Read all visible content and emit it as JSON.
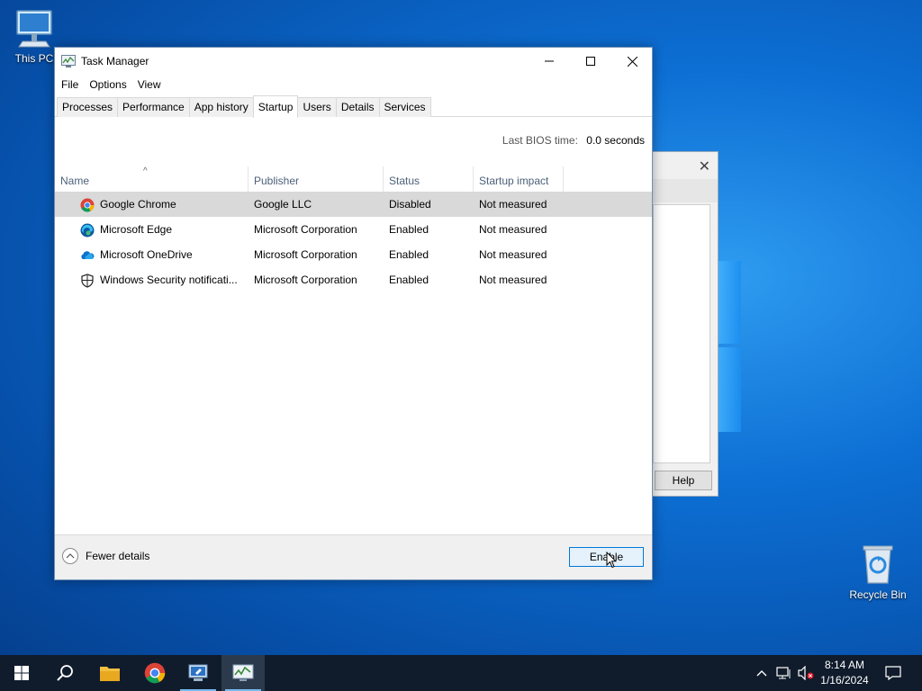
{
  "desktop": {
    "icons": [
      {
        "label": "This PC",
        "icon": "this-pc-icon"
      },
      {
        "label": "Recycle Bin",
        "icon": "recycle-bin-icon"
      }
    ]
  },
  "background_dialog": {
    "help_label": "Help"
  },
  "window": {
    "title": "Task Manager",
    "menu": [
      "File",
      "Options",
      "View"
    ],
    "tabs": [
      "Processes",
      "Performance",
      "App history",
      "Startup",
      "Users",
      "Details",
      "Services"
    ],
    "active_tab": "Startup",
    "bios": {
      "label": "Last BIOS time:",
      "value": "0.0 seconds"
    },
    "columns": [
      "Name",
      "Publisher",
      "Status",
      "Startup impact"
    ],
    "rows": [
      {
        "name": "Google Chrome",
        "publisher": "Google LLC",
        "status": "Disabled",
        "impact": "Not measured",
        "icon": "chrome-icon",
        "selected": true
      },
      {
        "name": "Microsoft Edge",
        "publisher": "Microsoft Corporation",
        "status": "Enabled",
        "impact": "Not measured",
        "icon": "edge-icon",
        "selected": false
      },
      {
        "name": "Microsoft OneDrive",
        "publisher": "Microsoft Corporation",
        "status": "Enabled",
        "impact": "Not measured",
        "icon": "onedrive-icon",
        "selected": false
      },
      {
        "name": "Windows Security notificati...",
        "publisher": "Microsoft Corporation",
        "status": "Enabled",
        "impact": "Not measured",
        "icon": "shield-icon",
        "selected": false
      }
    ],
    "footer": {
      "fewer_details": "Fewer details",
      "enable_button": "Enable"
    }
  },
  "taskbar": {
    "clock_time": "8:14 AM",
    "clock_date": "1/16/2024"
  },
  "colors": {
    "accent": "#0078d7",
    "selected_row": "#d9d9d9",
    "taskbar": "#101c2c"
  }
}
